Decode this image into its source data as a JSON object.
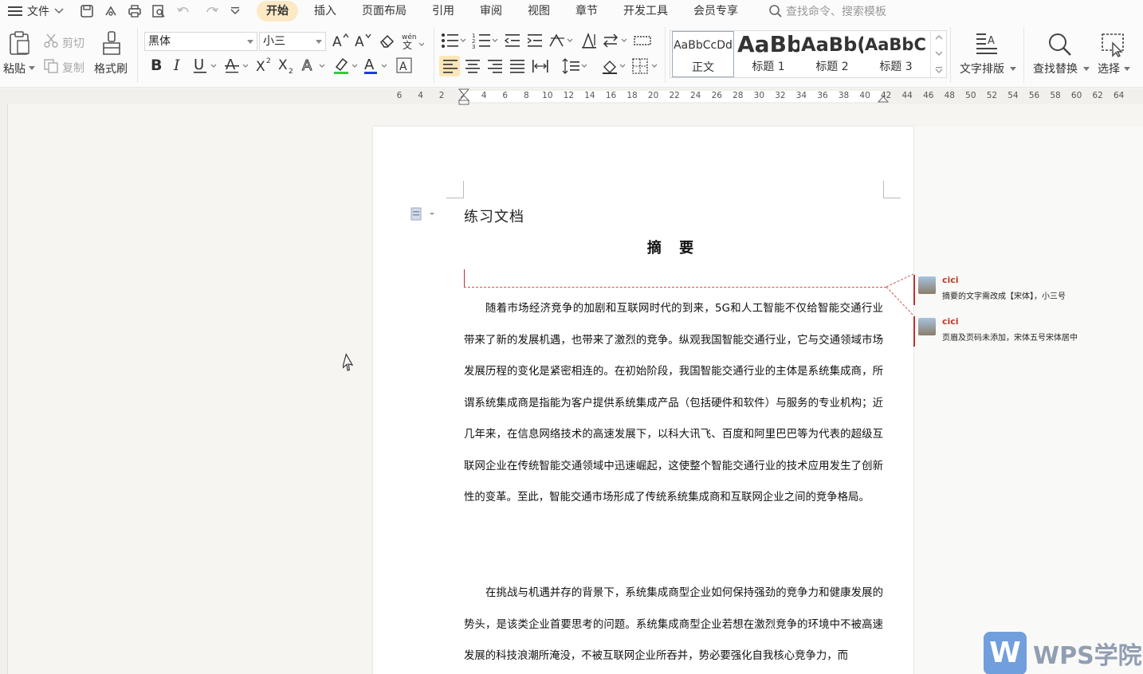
{
  "menubar": {
    "file_label": "文件",
    "tabs": [
      {
        "label": "开始",
        "active": true
      },
      {
        "label": "插入",
        "active": false
      },
      {
        "label": "页面布局",
        "active": false
      },
      {
        "label": "引用",
        "active": false
      },
      {
        "label": "审阅",
        "active": false
      },
      {
        "label": "视图",
        "active": false
      },
      {
        "label": "章节",
        "active": false
      },
      {
        "label": "开发工具",
        "active": false
      },
      {
        "label": "会员专享",
        "active": false
      }
    ],
    "search_placeholder": "查找命令、搜索模板"
  },
  "ribbon": {
    "paste": "粘贴",
    "cut": "剪切",
    "copy": "复制",
    "format_painter": "格式刷",
    "font_name": "黑体",
    "font_size": "小三",
    "styles": [
      {
        "preview": "AaBbCcDd",
        "label": "正文"
      },
      {
        "preview": "AaBb",
        "label": "标题 1"
      },
      {
        "preview": "AaBb(",
        "label": "标题 2"
      },
      {
        "preview": "AaBbC(",
        "label": "标题 3"
      }
    ],
    "text_layout": "文字排版",
    "find_replace": "查找替换",
    "select": "选择"
  },
  "ruler": {
    "numbers": [
      "6",
      "4",
      "2",
      "2",
      "4",
      "6",
      "8",
      "10",
      "12",
      "14",
      "16",
      "18",
      "20",
      "22",
      "24",
      "26",
      "28",
      "30",
      "32",
      "34",
      "36",
      "38",
      "40",
      "42",
      "44",
      "46",
      "48",
      "50",
      "52",
      "54",
      "56",
      "58",
      "60",
      "62",
      "64"
    ]
  },
  "document": {
    "title": "练习文档",
    "heading": "摘    要",
    "paragraphs": [
      "随着市场经济竞争的加剧和互联网时代的到来，5G和人工智能不仅给智能交通行业带来了新的发展机遇，也带来了激烈的竞争。纵观我国智能交通行业，它与交通领域市场发展历程的变化是紧密相连的。在初始阶段，我国智能交通行业的主体是系统集成商，所谓系统集成商是指能为客户提供系统集成产品（包括硬件和软件）与服务的专业机构；近几年来，在信息网络技术的高速发展下，以科大讯飞、百度和阿里巴巴等为代表的超级互联网企业在传统智能交通领域中迅速崛起，这使整个智能交通行业的技术应用发生了创新性的变革。至此，智能交通市场形成了传统系统集成商和互联网企业之间的竞争格局。",
      "在挑战与机遇并存的背景下，系统集成商型企业如何保持强劲的竞争力和健康发展的势头，是该类企业首要思考的问题。系统集成商型企业若想在激烈竞争的环境中不被高速发展的科技浪潮所淹没，不被互联网企业所吞并，势必要强化自我核心竞争力，而"
    ]
  },
  "comments": [
    {
      "author": "cici",
      "text": "摘要的文字需改成【宋体】，小三号"
    },
    {
      "author": "cici",
      "text": "页眉及页码未添加，宋体五号宋体居中"
    }
  ],
  "watermark": {
    "brand": "WPS学院"
  },
  "colors": {
    "active_tab_bg": "#fde9c4",
    "comment_author": "#c0392b",
    "comment_bar": "#b33333",
    "highlight_green": "#2ecc40",
    "font_color_blue": "#1a3fd8"
  }
}
